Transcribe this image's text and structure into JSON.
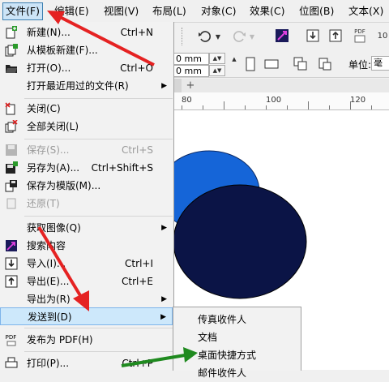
{
  "menubar": {
    "items": [
      "文件(F)",
      "编辑(E)",
      "视图(V)",
      "布局(L)",
      "对象(C)",
      "效果(C)",
      "位图(B)",
      "文本(X)"
    ]
  },
  "toolbar": {
    "pdf_label": "PDF"
  },
  "propbar": {
    "width_value": "0 mm",
    "height_value": "0 mm",
    "units_label": "单位:",
    "units_value": "毫"
  },
  "document_tab": {
    "add_label": "+"
  },
  "ruler": {
    "labels": [
      "80",
      "100",
      "120"
    ]
  },
  "file_menu": {
    "items": [
      {
        "label": "新建(N)...",
        "shortcut": "Ctrl+N",
        "icon": "new-document-icon"
      },
      {
        "label": "从模板新建(F)...",
        "shortcut": "",
        "icon": "new-from-template-icon"
      },
      {
        "label": "打开(O)...",
        "shortcut": "Ctrl+O",
        "icon": "open-folder-icon"
      },
      {
        "label": "打开最近用过的文件(R)",
        "shortcut": "",
        "icon": ""
      },
      {
        "label": "关闭(C)",
        "shortcut": "",
        "icon": "close-document-icon"
      },
      {
        "label": "全部关闭(L)",
        "shortcut": "",
        "icon": "close-all-icon"
      },
      {
        "label": "保存(S)...",
        "shortcut": "Ctrl+S",
        "icon": "save-icon"
      },
      {
        "label": "另存为(A)...",
        "shortcut": "Ctrl+Shift+S",
        "icon": "save-as-icon"
      },
      {
        "label": "保存为模版(M)...",
        "shortcut": "",
        "icon": "save-as-template-icon"
      },
      {
        "label": "还原(T)",
        "shortcut": "",
        "icon": "revert-icon"
      },
      {
        "label": "获取图像(Q)",
        "shortcut": "",
        "icon": ""
      },
      {
        "label": "搜索内容",
        "shortcut": "",
        "icon": "search-content-icon"
      },
      {
        "label": "导入(I)...",
        "shortcut": "Ctrl+I",
        "icon": "import-icon"
      },
      {
        "label": "导出(E)...",
        "shortcut": "Ctrl+E",
        "icon": "export-icon"
      },
      {
        "label": "导出为(R)",
        "shortcut": "",
        "icon": ""
      },
      {
        "label": "发送到(D)",
        "shortcut": "",
        "icon": ""
      },
      {
        "label": "发布为 PDF(H)",
        "shortcut": "",
        "icon": "publish-pdf-icon"
      },
      {
        "label": "打印(P)...",
        "shortcut": "Ctrl+P",
        "icon": "print-icon"
      }
    ]
  },
  "send_to_submenu": {
    "items": [
      "传真收件人",
      "文档",
      "桌面快捷方式",
      "邮件收件人"
    ]
  },
  "colors": {
    "highlight": "#cde8fb",
    "arrow_red": "#e52222",
    "arrow_green": "#1f8a1f",
    "circle_light": "#1565d8",
    "circle_dark": "#0b1446"
  }
}
